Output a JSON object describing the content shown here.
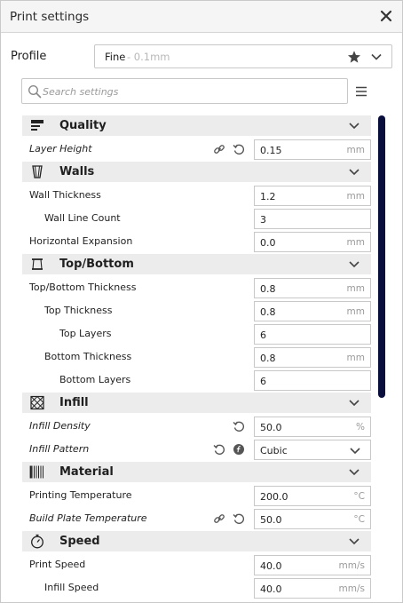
{
  "window": {
    "title": "Print settings"
  },
  "profile": {
    "label": "Profile",
    "name": "Fine",
    "detail": "- 0.1mm"
  },
  "search": {
    "placeholder": "Search settings"
  },
  "categories": {
    "quality": "Quality",
    "walls": "Walls",
    "topbottom": "Top/Bottom",
    "infill": "Infill",
    "material": "Material",
    "speed": "Speed"
  },
  "settings": {
    "layer_height": {
      "label": "Layer Height",
      "value": "0.15",
      "unit": "mm"
    },
    "wall_thickness": {
      "label": "Wall Thickness",
      "value": "1.2",
      "unit": "mm"
    },
    "wall_line_count": {
      "label": "Wall Line Count",
      "value": "3"
    },
    "horizontal_expansion": {
      "label": "Horizontal Expansion",
      "value": "0.0",
      "unit": "mm"
    },
    "topbottom_thickness": {
      "label": "Top/Bottom Thickness",
      "value": "0.8",
      "unit": "mm"
    },
    "top_thickness": {
      "label": "Top Thickness",
      "value": "0.8",
      "unit": "mm"
    },
    "top_layers": {
      "label": "Top Layers",
      "value": "6"
    },
    "bottom_thickness": {
      "label": "Bottom Thickness",
      "value": "0.8",
      "unit": "mm"
    },
    "bottom_layers": {
      "label": "Bottom Layers",
      "value": "6"
    },
    "infill_density": {
      "label": "Infill Density",
      "value": "50.0",
      "unit": "%"
    },
    "infill_pattern": {
      "label": "Infill Pattern",
      "value": "Cubic"
    },
    "printing_temperature": {
      "label": "Printing Temperature",
      "value": "200.0",
      "unit": "°C"
    },
    "build_plate_temperature": {
      "label": "Build Plate Temperature",
      "value": "50.0",
      "unit": "°C"
    },
    "print_speed": {
      "label": "Print Speed",
      "value": "40.0",
      "unit": "mm/s"
    },
    "infill_speed": {
      "label": "Infill Speed",
      "value": "40.0",
      "unit": "mm/s"
    }
  },
  "icons": {
    "close": "close-icon",
    "star": "star-icon",
    "chevron": "chevron-down-icon",
    "search": "search-icon",
    "menu": "hamburger-menu-icon",
    "link": "link-icon",
    "reset": "reset-icon",
    "formula": "formula-icon"
  },
  "colors": {
    "scrollbar": "#0a0e3d",
    "category_bg": "#ececec",
    "field_border": "#c8c8c8"
  }
}
